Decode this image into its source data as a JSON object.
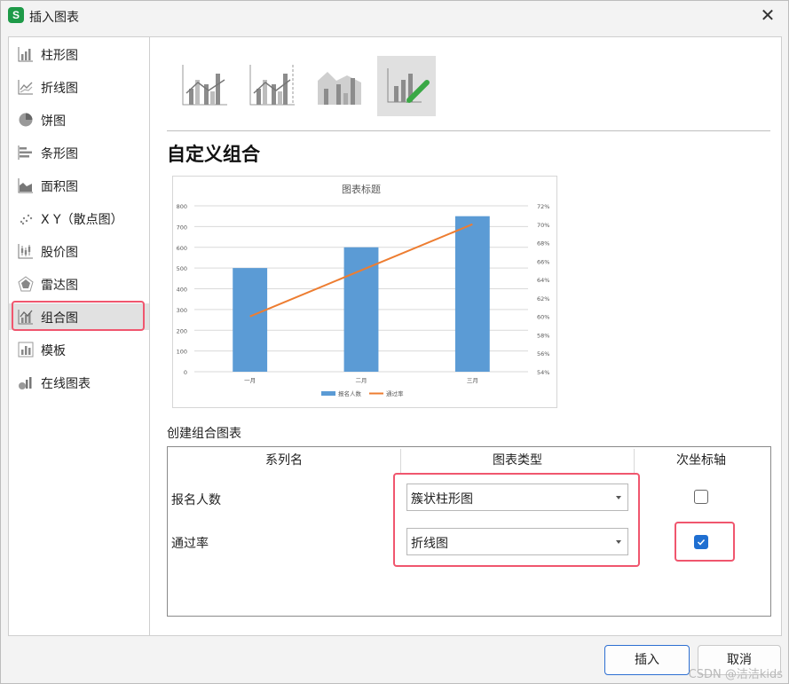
{
  "window": {
    "title": "插入图表",
    "app_icon_letter": "S"
  },
  "sidebar": {
    "items": [
      {
        "label": "柱形图",
        "icon": "bar-chart-icon"
      },
      {
        "label": "折线图",
        "icon": "line-chart-icon"
      },
      {
        "label": "饼图",
        "icon": "pie-chart-icon"
      },
      {
        "label": "条形图",
        "icon": "horizontal-bar-chart-icon"
      },
      {
        "label": "面积图",
        "icon": "area-chart-icon"
      },
      {
        "label": "X Y（散点图）",
        "icon": "scatter-chart-icon"
      },
      {
        "label": "股价图",
        "icon": "stock-chart-icon"
      },
      {
        "label": "雷达图",
        "icon": "radar-chart-icon"
      },
      {
        "label": "组合图",
        "icon": "combo-chart-icon",
        "selected": true
      },
      {
        "label": "模板",
        "icon": "template-icon"
      },
      {
        "label": "在线图表",
        "icon": "online-chart-icon"
      }
    ]
  },
  "main": {
    "subtypes": [
      "clustered-column-line-icon",
      "column-line-secondary-icon",
      "stacked-area-column-icon",
      "custom-combo-icon"
    ],
    "selected_subtype": 3,
    "heading": "自定义组合",
    "section_label": "创建组合图表",
    "table": {
      "headers": [
        "系列名",
        "图表类型",
        "次坐标轴"
      ],
      "rows": [
        {
          "name": "报名人数",
          "chart_type": "簇状柱形图",
          "secondary_axis": false
        },
        {
          "name": "通过率",
          "chart_type": "折线图",
          "secondary_axis": true
        }
      ]
    }
  },
  "buttons": {
    "insert": "插入",
    "cancel": "取消"
  },
  "watermark": "CSDN @洁洁kids",
  "colors": {
    "bar": "#5b9bd5",
    "line": "#ed7d31",
    "highlight": "#f0566e",
    "accent": "#1f6fd1"
  },
  "chart_data": {
    "type": "bar",
    "title": "图表标题",
    "categories": [
      "一月",
      "二月",
      "三月"
    ],
    "series": [
      {
        "name": "报名人数",
        "type": "bar",
        "values": [
          500,
          600,
          750
        ],
        "axis": "primary"
      },
      {
        "name": "通过率",
        "type": "line",
        "values": [
          0.6,
          0.65,
          0.7
        ],
        "axis": "secondary"
      }
    ],
    "ylim": [
      0,
      800
    ],
    "yticks": [
      "0",
      "100",
      "200",
      "300",
      "400",
      "500",
      "600",
      "700",
      "800"
    ],
    "y2lim": [
      0.54,
      0.72
    ],
    "y2ticks": [
      "54%",
      "56%",
      "58%",
      "60%",
      "62%",
      "64%",
      "66%",
      "68%",
      "70%",
      "72%"
    ],
    "legend": "bottom",
    "grid": true
  }
}
